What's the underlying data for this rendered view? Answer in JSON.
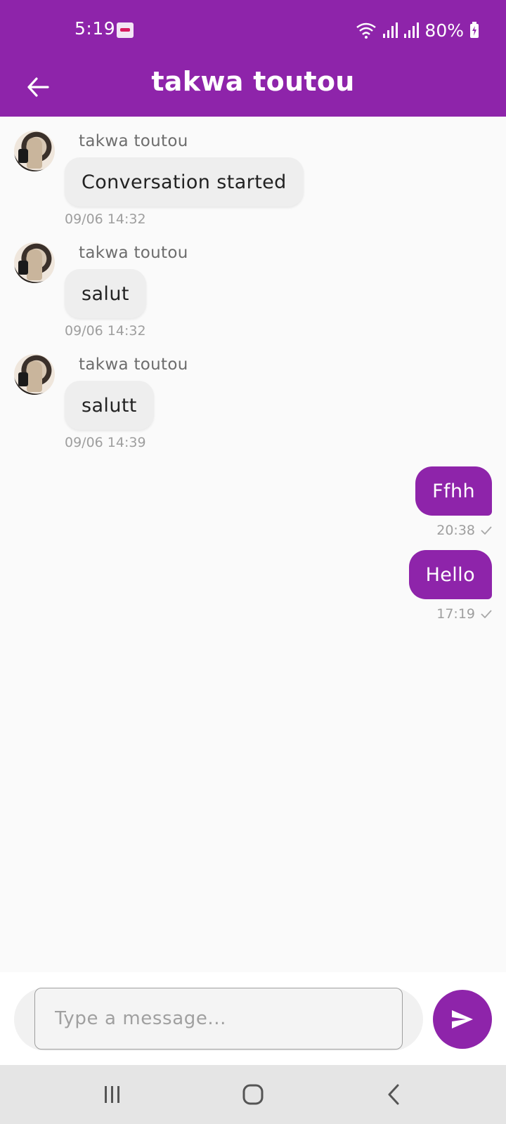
{
  "status_bar": {
    "time": "5:19",
    "battery": "80%",
    "icons": [
      "app-notification-icon",
      "wifi-icon",
      "signal-icon",
      "signal-icon",
      "battery-charging-icon"
    ]
  },
  "header": {
    "title": "takwa toutou",
    "back_icon": "arrow-left-icon",
    "background": "#8e24aa"
  },
  "messages": [
    {
      "direction": "incoming",
      "sender": "takwa toutou",
      "text": "Conversation started",
      "time": "09/06 14:32"
    },
    {
      "direction": "incoming",
      "sender": "takwa toutou",
      "text": "salut",
      "time": "09/06 14:32"
    },
    {
      "direction": "incoming",
      "sender": "takwa toutou",
      "text": "salutt",
      "time": "09/06 14:39"
    },
    {
      "direction": "outgoing",
      "text": "Ffhh",
      "time": "20:38",
      "status_icon": "check-icon"
    },
    {
      "direction": "outgoing",
      "text": "Hello",
      "time": "17:19",
      "status_icon": "check-icon"
    }
  ],
  "composer": {
    "placeholder": "Type a message...",
    "value": "",
    "send_icon": "send-icon"
  },
  "nav_bar": {
    "icons": [
      "recent-apps-icon",
      "home-icon",
      "back-icon"
    ]
  },
  "colors": {
    "accent": "#8e24aa",
    "incoming_bubble": "#eeeeee",
    "background": "#fafafa"
  }
}
